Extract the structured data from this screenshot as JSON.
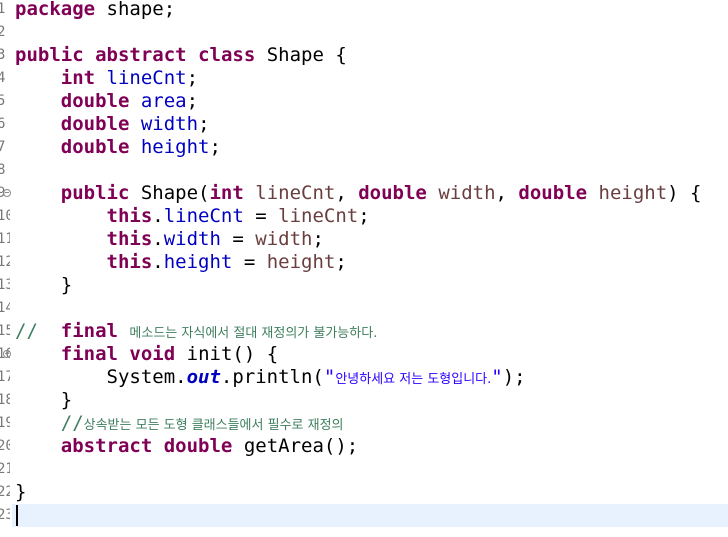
{
  "editor": {
    "lines": [
      {
        "n": "1",
        "segs": [
          {
            "t": "package",
            "c": "kw"
          },
          {
            "t": " shape;"
          }
        ]
      },
      {
        "n": "2",
        "segs": []
      },
      {
        "n": "3",
        "segs": [
          {
            "t": "public",
            "c": "kw"
          },
          {
            "t": " "
          },
          {
            "t": "abstract",
            "c": "kw"
          },
          {
            "t": " "
          },
          {
            "t": "class",
            "c": "kw"
          },
          {
            "t": " Shape {"
          }
        ]
      },
      {
        "n": "4",
        "segs": [
          {
            "t": "    "
          },
          {
            "t": "int",
            "c": "kw"
          },
          {
            "t": " "
          },
          {
            "t": "lineCnt",
            "c": "field"
          },
          {
            "t": ";"
          }
        ]
      },
      {
        "n": "5",
        "segs": [
          {
            "t": "    "
          },
          {
            "t": "double",
            "c": "kw"
          },
          {
            "t": " "
          },
          {
            "t": "area",
            "c": "field"
          },
          {
            "t": ";"
          }
        ]
      },
      {
        "n": "6",
        "segs": [
          {
            "t": "    "
          },
          {
            "t": "double",
            "c": "kw"
          },
          {
            "t": " "
          },
          {
            "t": "width",
            "c": "field"
          },
          {
            "t": ";"
          }
        ]
      },
      {
        "n": "7",
        "segs": [
          {
            "t": "    "
          },
          {
            "t": "double",
            "c": "kw"
          },
          {
            "t": " "
          },
          {
            "t": "height",
            "c": "field"
          },
          {
            "t": ";"
          }
        ]
      },
      {
        "n": "8",
        "segs": []
      },
      {
        "n": "9",
        "fold": true,
        "segs": [
          {
            "t": "    "
          },
          {
            "t": "public",
            "c": "kw"
          },
          {
            "t": " Shape("
          },
          {
            "t": "int",
            "c": "kw"
          },
          {
            "t": " "
          },
          {
            "t": "lineCnt",
            "c": "param"
          },
          {
            "t": ", "
          },
          {
            "t": "double",
            "c": "kw"
          },
          {
            "t": " "
          },
          {
            "t": "width",
            "c": "param"
          },
          {
            "t": ", "
          },
          {
            "t": "double",
            "c": "kw"
          },
          {
            "t": " "
          },
          {
            "t": "height",
            "c": "param"
          },
          {
            "t": ") {"
          }
        ]
      },
      {
        "n": "10",
        "segs": [
          {
            "t": "        "
          },
          {
            "t": "this",
            "c": "kw"
          },
          {
            "t": "."
          },
          {
            "t": "lineCnt",
            "c": "field"
          },
          {
            "t": " = "
          },
          {
            "t": "lineCnt",
            "c": "param"
          },
          {
            "t": ";"
          }
        ]
      },
      {
        "n": "11",
        "segs": [
          {
            "t": "        "
          },
          {
            "t": "this",
            "c": "kw"
          },
          {
            "t": "."
          },
          {
            "t": "width",
            "c": "field"
          },
          {
            "t": " = "
          },
          {
            "t": "width",
            "c": "param"
          },
          {
            "t": ";"
          }
        ]
      },
      {
        "n": "12",
        "segs": [
          {
            "t": "        "
          },
          {
            "t": "this",
            "c": "kw"
          },
          {
            "t": "."
          },
          {
            "t": "height",
            "c": "field"
          },
          {
            "t": " = "
          },
          {
            "t": "height",
            "c": "param"
          },
          {
            "t": ";"
          }
        ]
      },
      {
        "n": "13",
        "segs": [
          {
            "t": "    }"
          }
        ]
      },
      {
        "n": "14",
        "segs": []
      },
      {
        "n": "15",
        "segs": [
          {
            "t": "//  ",
            "c": "cm"
          },
          {
            "t": "final",
            "c": "kw"
          },
          {
            "t": " ",
            "c": "cm"
          },
          {
            "t": "메소드는 자식에서 절대 재정의가 불가능하다.",
            "c": "cm ko"
          }
        ]
      },
      {
        "n": "16",
        "fold": true,
        "segs": [
          {
            "t": "    "
          },
          {
            "t": "final",
            "c": "kw"
          },
          {
            "t": " "
          },
          {
            "t": "void",
            "c": "kw"
          },
          {
            "t": " init() {"
          }
        ]
      },
      {
        "n": "17",
        "segs": [
          {
            "t": "        System."
          },
          {
            "t": "out",
            "c": "static"
          },
          {
            "t": ".println("
          },
          {
            "t": "\"",
            "c": "str"
          },
          {
            "t": "안녕하세요 저는 도형입니다.",
            "c": "str ko"
          },
          {
            "t": "\"",
            "c": "str"
          },
          {
            "t": ");"
          }
        ]
      },
      {
        "n": "18",
        "segs": [
          {
            "t": "    }"
          }
        ]
      },
      {
        "n": "19",
        "segs": [
          {
            "t": "    //",
            "c": "cm"
          },
          {
            "t": "상속받는 모든 도형 클래스들에서 필수로 재정의",
            "c": "cm ko"
          }
        ]
      },
      {
        "n": "20",
        "segs": [
          {
            "t": "    "
          },
          {
            "t": "abstract",
            "c": "kw"
          },
          {
            "t": " "
          },
          {
            "t": "double",
            "c": "kw"
          },
          {
            "t": " getArea();"
          }
        ]
      },
      {
        "n": "21",
        "segs": []
      },
      {
        "n": "22",
        "segs": [
          {
            "t": "}"
          }
        ]
      },
      {
        "n": "23",
        "current": true,
        "segs": []
      }
    ]
  }
}
